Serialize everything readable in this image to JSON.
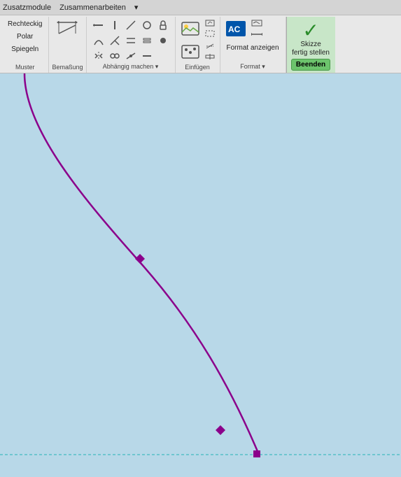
{
  "navbar": {
    "items": [
      "Zusatzmodule",
      "Zusammenarbeiten",
      "▾"
    ]
  },
  "toolbar": {
    "muster": {
      "label": "Muster",
      "items": [
        "Rechteckig",
        "Polar",
        "Spiegeln"
      ]
    },
    "bemassung": {
      "label": "Bemaßung"
    },
    "abhaengig": {
      "label": "Abhängig machen ▾"
    },
    "einfuegen": {
      "label": "Einfügen",
      "items": [
        "Bild",
        "Punkte",
        "ACAD"
      ]
    },
    "format": {
      "label": "Format ▾",
      "items": [
        "Format anzeigen"
      ]
    },
    "skizze": {
      "check": "✓",
      "line1": "Skizze",
      "line2": "fertig stellen",
      "btn_label": "Beenden"
    }
  },
  "canvas": {
    "background": "#b8d8e8"
  }
}
